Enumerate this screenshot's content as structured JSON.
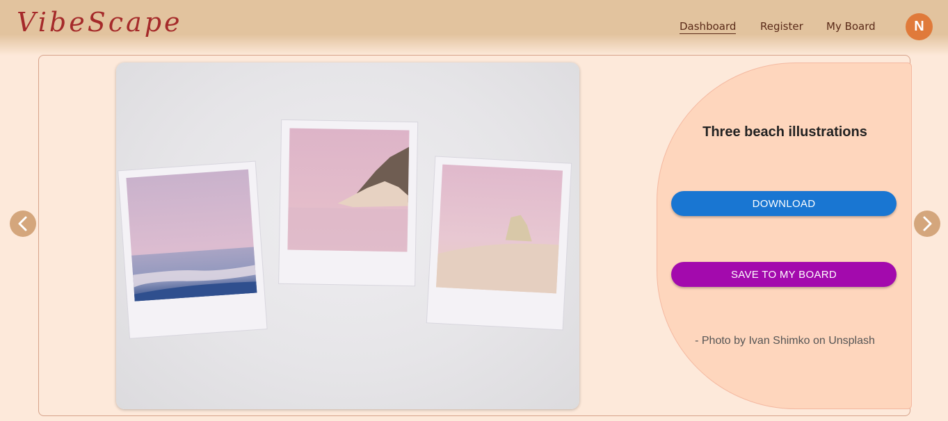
{
  "header": {
    "logo": "VibeScape",
    "nav": [
      "Dashboard",
      "Register",
      "My Board"
    ],
    "avatar_initial": "N"
  },
  "photo": {
    "icon": "polaroid-beach-photo"
  },
  "info": {
    "title": "Three beach illustrations",
    "download_label": "DOWNLOAD",
    "save_label": "SAVE TO MY BOARD",
    "credit": "- Photo by Ivan Shimko on Unsplash"
  },
  "colors": {
    "header": "#e2c39e",
    "background": "#fde9da",
    "logo": "#a52a2a",
    "avatar": "#e07a3a",
    "panel": "#fed6bd",
    "download": "#1976d2",
    "save": "#a30aad",
    "arrow": "#d4a67c"
  },
  "icons": {
    "prev": "chevron-left-icon",
    "next": "chevron-right-icon"
  }
}
